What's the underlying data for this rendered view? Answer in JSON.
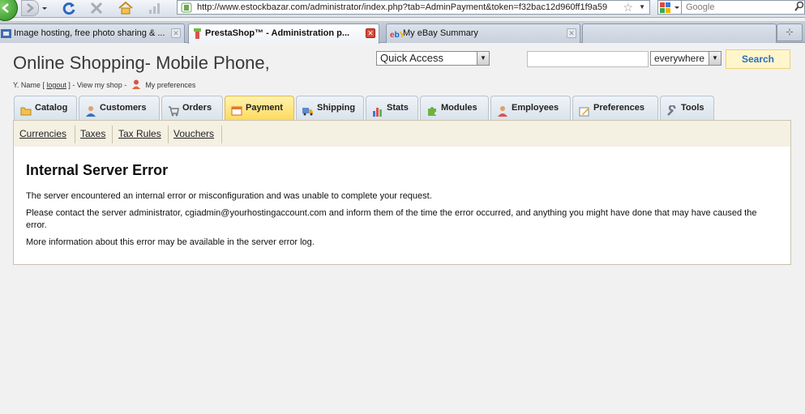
{
  "browser": {
    "url": "http://www.estockbazar.com/administrator/index.php?tab=AdminPayment&token=f32bac12d960ff1f9a59",
    "search_placeholder": "Google",
    "tabs": [
      {
        "title": "Image hosting, free photo sharing & ..."
      },
      {
        "title": "PrestaShop™ - Administration p..."
      },
      {
        "title": "My eBay Summary"
      }
    ]
  },
  "header": {
    "shop_title": "Online Shopping- Mobile Phone,",
    "user_name": "Y. Name [",
    "logout": "logout",
    "after_logout": "] - View my shop -",
    "preferences": "My preferences",
    "quick_access": "Quick Access",
    "search_scope": "everywhere",
    "search_button": "Search"
  },
  "admin_tabs": [
    {
      "label": "Catalog",
      "icon": "folder-icon"
    },
    {
      "label": "Customers",
      "icon": "customer-icon"
    },
    {
      "label": "Orders",
      "icon": "cart-icon"
    },
    {
      "label": "Payment",
      "icon": "payment-icon"
    },
    {
      "label": "Shipping",
      "icon": "truck-icon"
    },
    {
      "label": "Stats",
      "icon": "chart-icon"
    },
    {
      "label": "Modules",
      "icon": "puzzle-icon"
    },
    {
      "label": "Employees",
      "icon": "employee-icon"
    },
    {
      "label": "Preferences",
      "icon": "preferences-icon"
    },
    {
      "label": "Tools",
      "icon": "wrench-icon"
    }
  ],
  "sub_tabs": [
    "Currencies",
    "Taxes",
    "Tax Rules",
    "Vouchers"
  ],
  "error": {
    "title": "Internal Server Error",
    "line1": "The server encountered an internal error or misconfiguration and was unable to complete your request.",
    "line2": "Please contact the server administrator, cgiadmin@yourhostingaccount.com and inform them of the time the error occurred, and anything you might have done that may have caused the error.",
    "line3": "More information about this error may be available in the server error log."
  },
  "colors": {
    "active_tab": "#ffd95a",
    "search_button_text": "#2c6ebd",
    "subtab_bg": "#f4f0e2"
  }
}
